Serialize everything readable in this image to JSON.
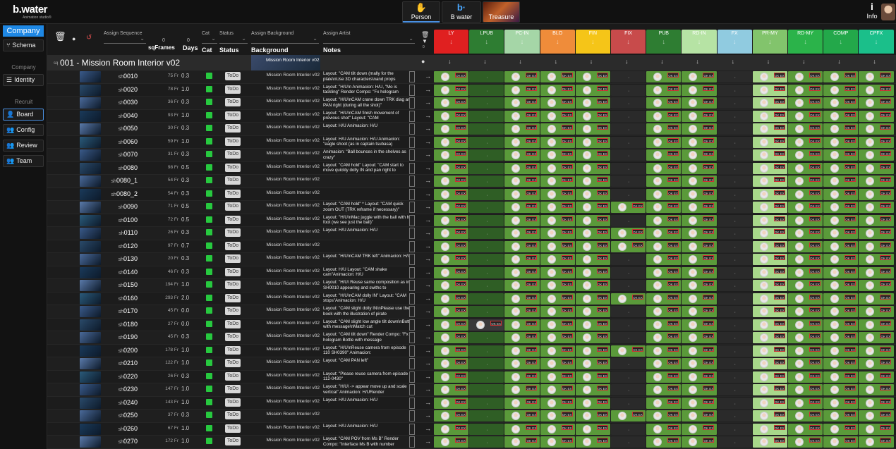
{
  "app": {
    "logo_name": "b.water",
    "logo_sub": "Animation studio®",
    "top_buttons": [
      {
        "label": "Person",
        "icon": "hand-icon"
      },
      {
        "label": "B water",
        "icon": "b-icon"
      },
      {
        "label": "Treasure",
        "icon": "treasure-thumb"
      }
    ],
    "info_label": "Info"
  },
  "sidebar": {
    "company_label": "Company",
    "schema_label": "Schema",
    "section_company": "Company",
    "identity_label": "Identity",
    "section_recruit": "Recruit",
    "board_label": "Board",
    "config_label": "Config",
    "review_label": "Review",
    "team_label": "Team"
  },
  "header": {
    "assign_sequence": "Assign Sequence",
    "frames_label": "sqFrames",
    "frames_value": "0",
    "days_label": "Days",
    "days_value": "0",
    "cat_small": "Cat",
    "cat_label": "Cat",
    "status_small": "Status",
    "status_label": "Status",
    "assign_background": "Assign Background",
    "background_label": "Background",
    "assign_artist": "Assign Artist",
    "notes_label": "Notes",
    "counter": "0"
  },
  "departments": [
    {
      "name": "LY",
      "color": "#e02020"
    },
    {
      "name": "LPUB",
      "color": "#2e7d32"
    },
    {
      "name": "PC-IN",
      "color": "#a5d6a7"
    },
    {
      "name": "BLO",
      "color": "#ef8c3a"
    },
    {
      "name": "FIN",
      "color": "#f5c518"
    },
    {
      "name": "FIX",
      "color": "#c84b4b"
    },
    {
      "name": "PUB",
      "color": "#2e7d32"
    },
    {
      "name": "RD-IN",
      "color": "#b6e3a4"
    },
    {
      "name": "FX",
      "color": "#90cbe0"
    },
    {
      "name": "PR-MY",
      "color": "#82c46c"
    },
    {
      "name": "RD-MY",
      "color": "#2bb34a"
    },
    {
      "name": "COMP",
      "color": "#23a84a"
    },
    {
      "name": "CPFX",
      "color": "#1bbf8a"
    }
  ],
  "sequence": {
    "prefix": "sq",
    "title": "001 - Mission Room Interior v02",
    "background": "Mission Room Interior v02"
  },
  "status_todo": "ToDo",
  "shot_prefix": "sh",
  "tag_label": "OK EX",
  "rows": [
    {
      "shot": "0010",
      "frames": "75 Fr",
      "days": "0.3",
      "bg": "Mission Room Interior v02",
      "note": "Layout: \"CAM tilt down (mally for the plate\\nUse 3D characters\\nand props"
    },
    {
      "shot": "0020",
      "frames": "78 Fr",
      "days": "1.0",
      "bg": "Mission Room Interior v02",
      "note": "Layout: \"H/U\\n Animacion: H/U, \"Mo is tackling\" Render Compo: \"Fx hologram"
    },
    {
      "shot": "0030",
      "frames": "36 Fr",
      "days": "0.3",
      "bg": "Mission Room Interior v02",
      "note": "Layout: \"H/U\\nCAM crane down TRK diag and PAN right (during all the shot)\""
    },
    {
      "shot": "0040",
      "frames": "93 Fr",
      "days": "1.0",
      "bg": "Mission Room Interior v02",
      "note": "Layout: \"H/U\\nCAM finish movement of previous shot\" Layout: \"CAM"
    },
    {
      "shot": "0050",
      "frames": "30 Fr",
      "days": "0.3",
      "bg": "Mission Room Interior v02",
      "note": "Layout: H/U Animacion: H/U"
    },
    {
      "shot": "0060",
      "frames": "59 Fr",
      "days": "1.0",
      "bg": "Mission Room Interior v02",
      "note": "Layout: H/U Animacion: H/U Animacion: \"eagle shoot (as in captain tsubasa)"
    },
    {
      "shot": "0070",
      "frames": "31 Fr",
      "days": "0.3",
      "bg": "Mission Room Interior v02",
      "note": "Animacion: \"Ball bounces in the shelves as crazy\""
    },
    {
      "shot": "0080",
      "frames": "98 Fr",
      "days": "0.5",
      "bg": "Mission Room Interior v02",
      "note": "Layout: \"CAM hold\" Layout: \"CAM start to move quickly dolly IN and pan right to"
    },
    {
      "shot": "0080_1",
      "frames": "54 Fr",
      "days": "0.3",
      "bg": "Mission Room Interior v02",
      "note": ""
    },
    {
      "shot": "0080_2",
      "frames": "54 Fr",
      "days": "0.3",
      "bg": "Mission Room Interior v02",
      "note": ""
    },
    {
      "shot": "0090",
      "frames": "71 Fr",
      "days": "0.5",
      "bg": "Mission Room Interior v02",
      "note": "Layout: \"CAM hold\" * Layout: \"CAM quick zoom OUT (TRK reframe if necessary)\""
    },
    {
      "shot": "0100",
      "frames": "72 Fr",
      "days": "0.5",
      "bg": "Mission Room Interior v02",
      "note": "Layout: \"H/U\\nMac juggle with the ball with her foot (we see just the ball)\""
    },
    {
      "shot": "0110",
      "frames": "26 Fr",
      "days": "0.3",
      "bg": "Mission Room Interior v02",
      "note": "Layout: H/U Animacion: H/U"
    },
    {
      "shot": "0120",
      "frames": "97 Fr",
      "days": "0.7",
      "bg": "Mission Room Interior v02",
      "note": ""
    },
    {
      "shot": "0130",
      "frames": "20 Fr",
      "days": "0.3",
      "bg": "Mission Room Interior v02",
      "note": "Layout: \"H/U\\nCAM TRK left\" Animacion: H/U"
    },
    {
      "shot": "0140",
      "frames": "46 Fr",
      "days": "0.3",
      "bg": "Mission Room Interior v02",
      "note": "Layout: H/U Layout: \"CAM shake cam\"Animacion: H/U"
    },
    {
      "shot": "0150",
      "frames": "194 Fr",
      "days": "1.0",
      "bg": "Mission Room Interior v02",
      "note": "Layout: \"H/U\\ Reuse same composition as in SH0010 appearing and swithc to"
    },
    {
      "shot": "0160",
      "frames": "293 Fr",
      "days": "2.0",
      "bg": "Mission Room Interior v02",
      "note": "Layout: \"H/U\\nCAM dolly IN\" Layout: \"CAM stops\"Animacion: H/U"
    },
    {
      "shot": "0170",
      "frames": "45 Fr",
      "days": "0.0",
      "bg": "Mission Room Interior v02",
      "note": "Layout: \"CAM slight dolly IN\\nPlease use the book with the illustration of pirate"
    },
    {
      "shot": "0180",
      "frames": "27 Fr",
      "days": "0.0",
      "bg": "Mission Room Interior v02",
      "note": "Layout: \"CAM slight low angle tilt down\\nBottle with message\\nMatch cut"
    },
    {
      "shot": "0190",
      "frames": "45 Fr",
      "days": "0.3",
      "bg": "Mission Room Interior v02",
      "note": "Layout: \"CAM tilt down\" Render Compo: \"Fx hologram Bottle with message"
    },
    {
      "shot": "0200",
      "frames": "178 Fr",
      "days": "1.0",
      "bg": "Mission Room Interior v02",
      "note": "Layout: \"H/U\\nReuse camera from episode 110 SH0390\" Animacion:"
    },
    {
      "shot": "0210",
      "frames": "122 Fr",
      "days": "1.0",
      "bg": "Mission Room Interior v02",
      "note": "Layout: \"CAM PAN left\""
    },
    {
      "shot": "0220",
      "frames": "26 Fr",
      "days": "0.3",
      "bg": "Mission Room Interior v02",
      "note": "Layout: \"Please reuse camera from episode 112-0430\""
    },
    {
      "shot": "0230",
      "frames": "147 Fr",
      "days": "1.0",
      "bg": "Mission Room Interior v02",
      "note": "Layout: \"H/U\\ -> appear move up and scale vertical\" Animacion: H/URender"
    },
    {
      "shot": "0240",
      "frames": "143 Fr",
      "days": "1.0",
      "bg": "Mission Room Interior v02",
      "note": "Layout: H/U Animacion: H/U"
    },
    {
      "shot": "0250",
      "frames": "37 Fr",
      "days": "0.3",
      "bg": "Mission Room Interior v02",
      "note": ""
    },
    {
      "shot": "0260",
      "frames": "67 Fr",
      "days": "1.0",
      "bg": "Mission Room Interior v02",
      "note": "Layout: H/U Animacion: H/U"
    },
    {
      "shot": "0270",
      "frames": "172 Fr",
      "days": "1.0",
      "bg": "Mission Room Interior v02",
      "note": "Layout: \"CAM POV from Ms B\" Render Compo: \"Interface Ms B with number"
    }
  ]
}
